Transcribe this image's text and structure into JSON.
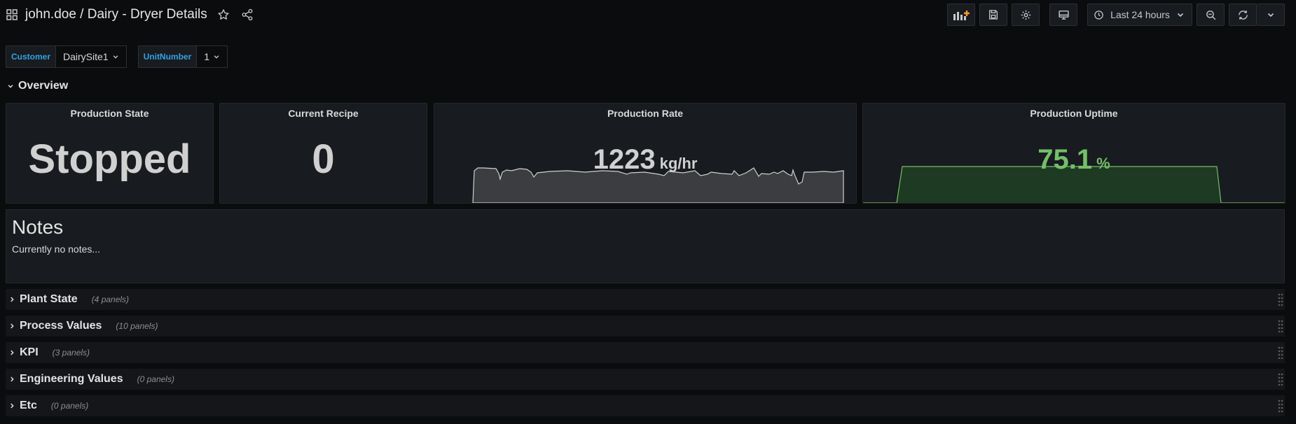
{
  "nav": {
    "title": "john.doe / Dairy - Dryer Details",
    "time_range": "Last 24 hours"
  },
  "variables": [
    {
      "label": "Customer",
      "value": "DairySite1"
    },
    {
      "label": "UnitNumber",
      "value": "1"
    }
  ],
  "overview": {
    "title": "Overview",
    "panels": {
      "production_state": {
        "title": "Production State",
        "value": "Stopped"
      },
      "current_recipe": {
        "title": "Current Recipe",
        "value": "0"
      },
      "production_rate": {
        "title": "Production Rate",
        "value": "1223",
        "unit": "kg/hr",
        "color": "#d0d0d0"
      },
      "production_uptime": {
        "title": "Production Uptime",
        "value": "75.1",
        "unit": "%",
        "color": "#73bf69"
      }
    }
  },
  "notes": {
    "heading": "Notes",
    "text": "Currently no notes..."
  },
  "rows": [
    {
      "name": "Plant State",
      "count": "(4 panels)"
    },
    {
      "name": "Process Values",
      "count": "(10 panels)"
    },
    {
      "name": "KPI",
      "count": "(3 panels)"
    },
    {
      "name": "Engineering Values",
      "count": "(0 panels)"
    },
    {
      "name": "Etc",
      "count": "(0 panels)"
    }
  ],
  "colors": {
    "accent": "#33a2e5",
    "green": "#73bf69",
    "background": "#0b0c0e",
    "panel": "#181b1f"
  },
  "icons": {
    "dashboard": "grid-icon",
    "star": "star-icon",
    "share": "share-icon",
    "add_panel": "add-panel-icon",
    "save": "save-icon",
    "settings": "gear-icon",
    "tv": "tv-icon",
    "clock": "clock-icon",
    "zoom_out": "zoom-out-icon",
    "refresh": "refresh-icon"
  }
}
